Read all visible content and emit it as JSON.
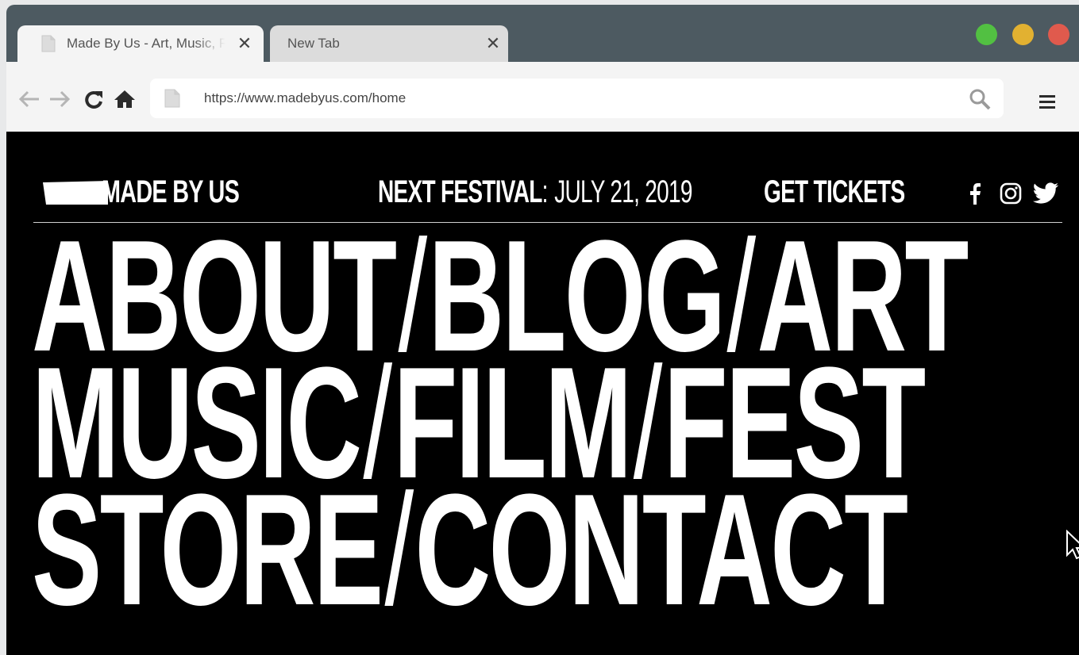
{
  "browser": {
    "tabs": [
      {
        "title": "Made By Us - Art, Music, Film",
        "active": true
      },
      {
        "title": "New Tab",
        "active": false
      }
    ],
    "close_glyph": "✕",
    "url": "https://www.madebyus.com/home",
    "icons": {
      "back": "arrow-left-icon",
      "forward": "arrow-right-icon",
      "reload": "reload-icon",
      "home": "home-icon",
      "search": "search-icon",
      "menu": "hamburger-menu-icon"
    },
    "traffic_colors": [
      "#52c042",
      "#e2b131",
      "#e05a4d"
    ]
  },
  "site": {
    "logo_text": "MADE BY US",
    "festival_label": "NEXT FESTIVAL",
    "festival_sep": ":",
    "festival_date": "JULY 21, 2019",
    "tickets_label": "GET TICKETS",
    "social": [
      "facebook-icon",
      "instagram-icon",
      "twitter-icon"
    ],
    "nav_lines": [
      [
        "ABOUT",
        "BLOG",
        "ART"
      ],
      [
        "MUSIC",
        "FILM",
        "FEST"
      ],
      [
        "STORE",
        "CONTACT"
      ]
    ],
    "separator": "/",
    "colors": {
      "background": "#000000",
      "text": "#ffffff"
    }
  }
}
